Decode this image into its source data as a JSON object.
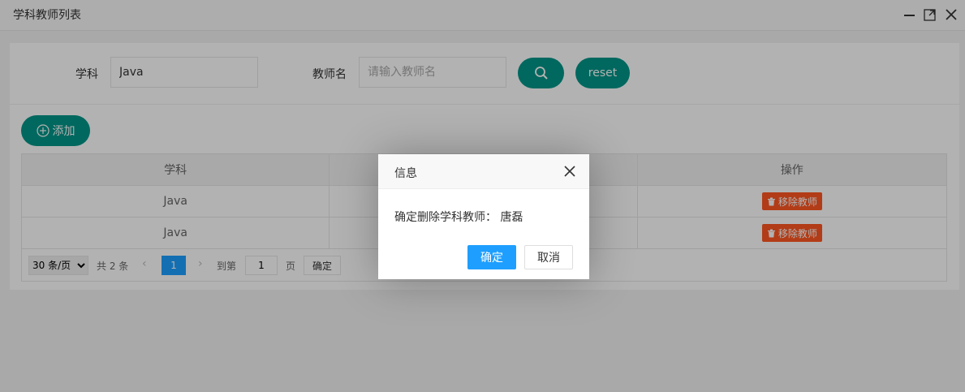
{
  "window": {
    "title": "学科教师列表",
    "minimize_icon": "minimize-icon",
    "maximize_icon": "maximize-icon",
    "close_icon": "close-icon"
  },
  "search": {
    "subject_label": "学科",
    "subject_value": "Java",
    "teacher_label": "教师名",
    "teacher_placeholder": "请输入教师名",
    "search_icon": "search-icon",
    "reset_label": "reset"
  },
  "toolbar": {
    "add_label": "添加",
    "add_icon": "plus-circle-icon"
  },
  "table": {
    "headers": [
      "学科",
      "",
      "操作"
    ],
    "rows": [
      {
        "subject": "Java",
        "teacher": "",
        "action": "移除教师"
      },
      {
        "subject": "Java",
        "teacher": "",
        "action": "移除教师"
      }
    ]
  },
  "pagination": {
    "page_size_selected": "30 条/页",
    "total_text": "共 2 条",
    "current_page": "1",
    "goto_label": "到第",
    "goto_value": "1",
    "page_unit": "页",
    "confirm_label": "确定"
  },
  "dialog": {
    "title": "信息",
    "message": "确定删除学科教师： 唐磊",
    "confirm_label": "确定",
    "cancel_label": "取消"
  },
  "colors": {
    "primary_teal": "#009688",
    "danger": "#FF5722",
    "primary_blue": "#1E9FFF"
  }
}
